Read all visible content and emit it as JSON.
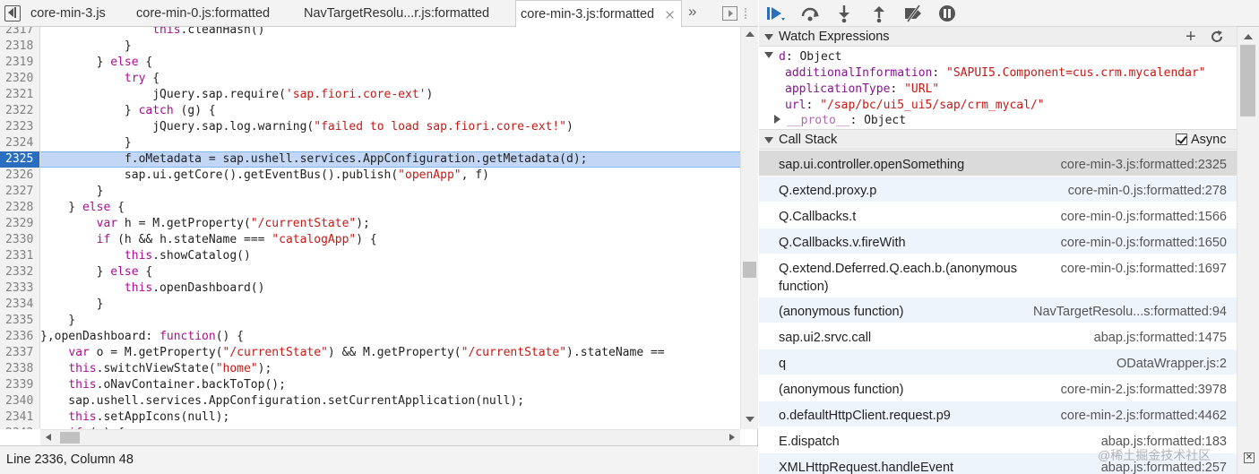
{
  "tabs": [
    {
      "label": "core-min-3.js",
      "active": false
    },
    {
      "label": "core-min-0.js:formatted",
      "active": false
    },
    {
      "label": "NavTargetResolu...r.js:formatted",
      "active": false
    },
    {
      "label": "core-min-3.js:formatted",
      "active": true
    }
  ],
  "tab_overflow": "»",
  "code_lines": [
    {
      "num": "2317",
      "html": "                <span class=\"t-kw\">this</span>.cleanHash()"
    },
    {
      "num": "2318",
      "html": "            }"
    },
    {
      "num": "2319",
      "html": "        } <span class=\"t-kw\">else</span> {"
    },
    {
      "num": "2320",
      "html": "            <span class=\"t-kw\">try</span> {"
    },
    {
      "num": "2321",
      "html": "                jQuery.sap.require(<span class=\"t-str\">'sap.fiori.core-ext'</span>)"
    },
    {
      "num": "2322",
      "html": "            } <span class=\"t-kw\">catch</span> (g) {"
    },
    {
      "num": "2323",
      "html": "                jQuery.sap.log.warning(<span class=\"t-str\">\"failed to load sap.fiori.core-ext!\"</span>)"
    },
    {
      "num": "2324",
      "html": "            }"
    },
    {
      "num": "2325",
      "html": "            f.oMetadata = sap.ushell.services.AppConfiguration.getMetadata(d);",
      "active": true
    },
    {
      "num": "2326",
      "html": "            sap.ui.getCore().getEventBus().publish(<span class=\"t-str\">\"openApp\"</span>, f)"
    },
    {
      "num": "2327",
      "html": "        }"
    },
    {
      "num": "2328",
      "html": "    } <span class=\"t-kw\">else</span> {"
    },
    {
      "num": "2329",
      "html": "        <span class=\"t-kw\">var</span> h = M.getProperty(<span class=\"t-str\">\"/currentState\"</span>);"
    },
    {
      "num": "2330",
      "html": "        <span class=\"t-kw\">if</span> (h &amp;&amp; h.stateName === <span class=\"t-str\">\"catalogApp\"</span>) {"
    },
    {
      "num": "2331",
      "html": "            <span class=\"t-kw\">this</span>.showCatalog()"
    },
    {
      "num": "2332",
      "html": "        } <span class=\"t-kw\">else</span> {"
    },
    {
      "num": "2333",
      "html": "            <span class=\"t-kw\">this</span>.openDashboard()"
    },
    {
      "num": "2334",
      "html": "        }"
    },
    {
      "num": "2335",
      "html": "    }"
    },
    {
      "num": "2336",
      "html": "},openDashboard: <span class=\"t-kw\">function</span>() {"
    },
    {
      "num": "2337",
      "html": "    <span class=\"t-kw\">var</span> o = M.getProperty(<span class=\"t-str\">\"/currentState\"</span>) &amp;&amp; M.getProperty(<span class=\"t-str\">\"/currentState\"</span>).stateName =="
    },
    {
      "num": "2338",
      "html": "    <span class=\"t-kw\">this</span>.switchViewState(<span class=\"t-str\">\"home\"</span>);"
    },
    {
      "num": "2339",
      "html": "    <span class=\"t-kw\">this</span>.oNavContainer.backToTop();"
    },
    {
      "num": "2340",
      "html": "    sap.ushell.services.AppConfiguration.setCurrentApplication(null);"
    },
    {
      "num": "2341",
      "html": "    <span class=\"t-kw\">this</span>.setAppIcons(null);"
    },
    {
      "num": "2342",
      "html": "    <span class=\"t-kw\">if</span> (o) {"
    }
  ],
  "status_text": "Line 2336, Column 48",
  "watch": {
    "title": "Watch Expressions",
    "plus": "+",
    "root_key": "d",
    "root_value": "Object",
    "props": [
      {
        "key": "additionalInformation",
        "value": "\"SAPUI5.Component=cus.crm.mycalendar\""
      },
      {
        "key": "applicationType",
        "value": "\"URL\""
      },
      {
        "key": "url",
        "value": "\"/sap/bc/ui5_ui5/sap/crm_mycal/\""
      }
    ],
    "proto_key": "__proto__",
    "proto_value": "Object"
  },
  "callstack": {
    "title": "Call Stack",
    "async_label": "Async",
    "async_checked": true,
    "frames": [
      {
        "fn": "sap.ui.controller.openSomething",
        "loc": "core-min-3.js:formatted:2325",
        "h": 29
      },
      {
        "fn": "Q.extend.proxy.p",
        "loc": "core-min-0.js:formatted:278",
        "h": 29
      },
      {
        "fn": "Q.Callbacks.t",
        "loc": "core-min-0.js:formatted:1566",
        "h": 29
      },
      {
        "fn": "Q.Callbacks.v.fireWith",
        "loc": "core-min-0.js:formatted:1650",
        "h": 29
      },
      {
        "fn": "Q.extend.Deferred.Q.each.b.(anonymous function)",
        "loc": "core-min-0.js:formatted:1697",
        "h": 48
      },
      {
        "fn": "(anonymous function)",
        "loc": "NavTargetResolu...s:formatted:94",
        "h": 29
      },
      {
        "fn": "sap.ui2.srvc.call",
        "loc": "abap.js:formatted:1475",
        "h": 29
      },
      {
        "fn": "q",
        "loc": "ODataWrapper.js:2",
        "h": 29
      },
      {
        "fn": "(anonymous function)",
        "loc": "core-min-2.js:formatted:3978",
        "h": 29
      },
      {
        "fn": "o.defaultHttpClient.request.p9",
        "loc": "core-min-2.js:formatted:4462",
        "h": 29
      },
      {
        "fn": "E.dispatch",
        "loc": "abap.js:formatted:183",
        "h": 29
      },
      {
        "fn": "XMLHttpRequest.handleEvent",
        "loc": "abap.js:formatted:257",
        "h": 29
      }
    ]
  },
  "watermark": "@稀土掘金技术社区",
  "colors": {
    "active_line": "#c2d7f5",
    "gutter_marker": "#2a6ebd",
    "keyword": "#aa0d91",
    "string": "#c41a16",
    "debugger_blue": "#2a6ebd"
  }
}
